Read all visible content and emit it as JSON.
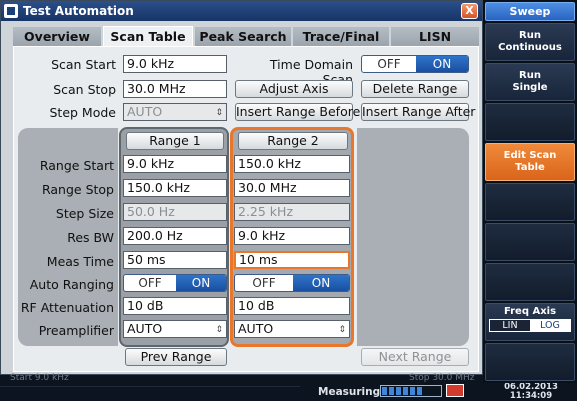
{
  "window": {
    "title": "Test Automation",
    "close": "X"
  },
  "tabs": [
    "Overview",
    "Scan Table",
    "Peak Search",
    "Trace/Final Meas",
    "LISN Settings"
  ],
  "scan": {
    "start_label": "Scan Start",
    "start_value": "9.0 kHz",
    "stop_label": "Scan Stop",
    "stop_value": "30.0 MHz",
    "step_mode_label": "Step Mode",
    "step_mode_value": "AUTO",
    "tds_label": "Time Domain Scan",
    "tds_off": "OFF",
    "tds_on": "ON",
    "adjust_axis": "Adjust Axis",
    "delete_range": "Delete Range",
    "insert_before": "Insert Range Before",
    "insert_after": "Insert Range After"
  },
  "rows": [
    "Range Start",
    "Range Stop",
    "Step Size",
    "Res BW",
    "Meas Time",
    "Auto Ranging",
    "RF Attenuation",
    "Preamplifier"
  ],
  "range1": {
    "header": "Range 1",
    "start": "9.0 kHz",
    "stop": "150.0 kHz",
    "step": "50.0 Hz",
    "rbw": "200.0 Hz",
    "meas_time": "50 ms",
    "auto_off": "OFF",
    "auto_on": "ON",
    "rf_att": "10 dB",
    "preamp": "AUTO"
  },
  "range2": {
    "header": "Range 2",
    "start": "150.0 kHz",
    "stop": "30.0 MHz",
    "step": "2.25 kHz",
    "rbw": "9.0 kHz",
    "meas_time": "10 ms",
    "auto_off": "OFF",
    "auto_on": "ON",
    "rf_att": "10 dB",
    "preamp": "AUTO"
  },
  "nav": {
    "prev": "Prev Range",
    "next": "Next Range"
  },
  "status": {
    "faint_left": "Start 9.0 kHz",
    "faint_right": "Stop 30.0 MHz",
    "measuring": "Measuring...",
    "date": "06.02.2013",
    "time": "11:34:09"
  },
  "softkeys": {
    "title": "Sweep",
    "run_cont_1": "Run",
    "run_cont_2": "Continuous",
    "run_single_1": "Run",
    "run_single_2": "Single",
    "edit_1": "Edit Scan",
    "edit_2": "Table",
    "freq_axis": "Freq Axis",
    "lin": "LIN",
    "log": "LOG"
  },
  "colors": {
    "accent_orange": "#e8772b",
    "toggle_blue": "#1a4fa0",
    "softkey_title": "#2a63c0"
  }
}
